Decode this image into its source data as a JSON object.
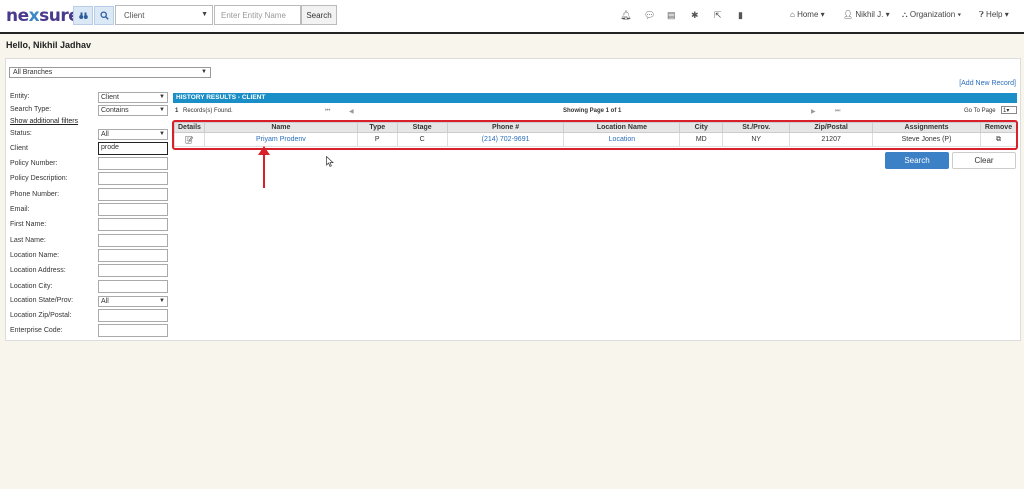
{
  "header": {
    "logo_pre": "ne",
    "logo_x": "x",
    "logo_post": "sure",
    "entity_select": "Client",
    "entity_placeholder": "Enter Entity Name",
    "search_button": "Search",
    "menus": {
      "home": "Home",
      "user": "Nikhil J.",
      "organization": "Organization",
      "help": "Help"
    }
  },
  "greeting": "Hello, Nikhil Jadhav",
  "branch_select": "All Branches",
  "add_new_record": "[Add New Record]",
  "filters": {
    "entity_label": "Entity:",
    "entity_value": "Client",
    "search_type_label": "Search Type:",
    "search_type_value": "Contains",
    "show_additional": "Show additional filters",
    "status_label": "Status:",
    "status_value": "All",
    "client_label": "Client",
    "client_value": "prode",
    "policy_number_label": "Policy Number:",
    "policy_description_label": "Policy Description:",
    "phone_number_label": "Phone Number:",
    "email_label": "Email:",
    "first_name_label": "First Name:",
    "last_name_label": "Last Name:",
    "location_name_label": "Location Name:",
    "location_address_label": "Location Address:",
    "location_city_label": "Location City:",
    "location_state_label": "Location State/Prov:",
    "location_state_value": "All",
    "location_zip_label": "Location Zip/Postal:",
    "enterprise_code_label": "Enterprise Code:"
  },
  "results": {
    "header": "HISTORY RESULTS - CLIENT",
    "records_count": "1",
    "records_found": "Records(s) Found.",
    "showing": "Showing Page 1 of 1",
    "go_to_page": "Go To Page",
    "go_to_value": "1",
    "columns": [
      "Details",
      "Name",
      "Type",
      "Stage",
      "Phone #",
      "Location Name",
      "City",
      "St./Prov.",
      "Zip/Postal",
      "Assignments",
      "Remove"
    ],
    "row": {
      "name": "Priyam Prodenv",
      "type": "P",
      "stage": "C",
      "phone": "(214) 702-9691",
      "location_name": "Location",
      "city": "MD",
      "state": "NY",
      "zip": "21207",
      "assignments": "Steve Jones (P)"
    }
  },
  "buttons": {
    "search": "Search",
    "clear": "Clear"
  }
}
